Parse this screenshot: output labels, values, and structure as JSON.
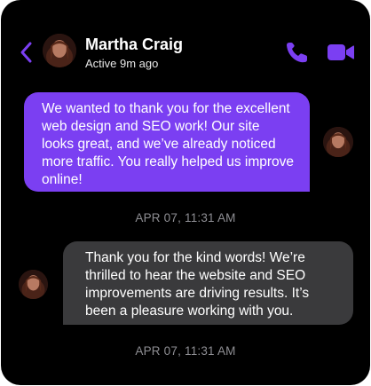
{
  "header": {
    "contact_name": "Martha Craig",
    "status": "Active 9m ago",
    "icons": {
      "back": "chevron-left-icon",
      "call": "phone-icon",
      "video": "video-camera-icon"
    },
    "accent_color": "#7b3ff2"
  },
  "messages": [
    {
      "direction": "outgoing",
      "text": "We wanted to thank you for the excellent web design and SEO work! Our site looks great, and we’ve already noticed more traffic. You really helped us improve online!",
      "timestamp": "APR 07, 11:31 AM",
      "bubble_color": "#7b3ff2"
    },
    {
      "direction": "incoming",
      "text": "Thank you for the kind words! We’re thrilled to hear the website and SEO improvements are driving results. It’s been a pleasure working with you.",
      "timestamp": "APR 07, 11:31 AM",
      "bubble_color": "#3a3a3c"
    }
  ]
}
